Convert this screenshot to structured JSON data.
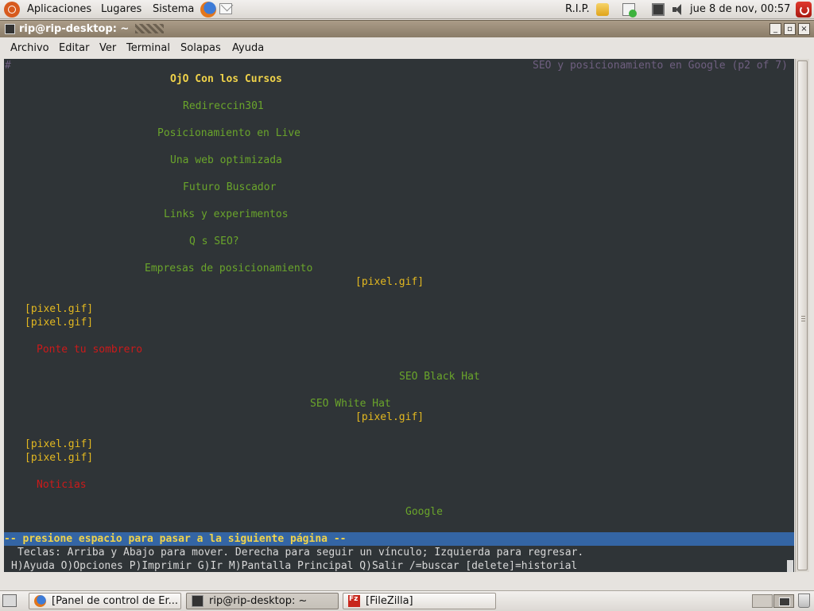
{
  "top_panel": {
    "menus": [
      "Aplicaciones",
      "Lugares",
      "Sistema"
    ],
    "tray_label": "R.I.P.",
    "clock": "jue  8 de nov, 00:57"
  },
  "window": {
    "title": "rip@rip-desktop: ~",
    "menu": [
      "Archivo",
      "Editar",
      "Ver",
      "Terminal",
      "Solapas",
      "Ayuda"
    ]
  },
  "terminal": {
    "corner_mark": "#",
    "page_header": "SEO y posicionamiento en Google (p2 of 7)",
    "lines": {
      "l1": "OjO Con los Cursos",
      "l2": "Redireccin301",
      "l3": "Posicionamiento en Live",
      "l4": "Una web optimizada",
      "l5": "Futuro Buscador",
      "l6": "Links y experimentos",
      "l7": "Q s SEO?",
      "l8": "Empresas de posicionamiento",
      "l9": "[pixel.gif]",
      "l10": "[pixel.gif]",
      "l11": "[pixel.gif]",
      "l12": "Ponte tu sombrero",
      "l13": "SEO Black Hat",
      "l14": "SEO White Hat",
      "l15": "[pixel.gif]",
      "l16": "[pixel.gif]",
      "l17": "[pixel.gif]",
      "l18": "Noticias",
      "l19": "Google"
    },
    "status": "-- presione espacio para pasar a la siguiente página --",
    "help_keys": "Teclas: Arriba y Abajo para mover. Derecha para seguir un vínculo; Izquierda para regresar.",
    "help_cmds": "H)Ayuda O)Opciones P)Imprimir G)Ir M)Pantalla Principal Q)Salir /=buscar [delete]=historial"
  },
  "taskbar": {
    "tasks": [
      "[Panel de control de Er...",
      "rip@rip-desktop: ~",
      "[FileZilla]"
    ]
  }
}
